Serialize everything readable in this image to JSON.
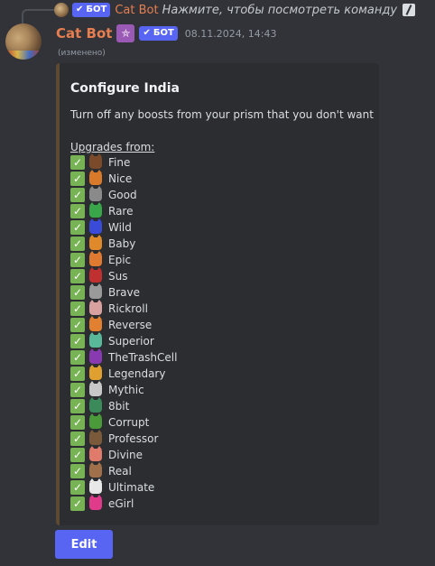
{
  "reply": {
    "author": "Cat Bot",
    "bot_tag": "БОТ",
    "text": "Нажмите, чтобы посмотреть команду"
  },
  "message": {
    "author": "Cat Bot",
    "bot_tag": "БОТ",
    "timestamp": "08.11.2024, 14:43",
    "edited": "(изменено)",
    "author_color": "#e67e50"
  },
  "embed": {
    "title": "Configure India",
    "description": "Turn off any boosts from your prism that you don't want",
    "upgrades_label": "Upgrades from:",
    "accent_color": "#5c4a32",
    "items": [
      {
        "label": "Fine",
        "color": "#7a4a2a"
      },
      {
        "label": "Nice",
        "color": "#d97a2a"
      },
      {
        "label": "Good",
        "color": "#8a8a8a"
      },
      {
        "label": "Rare",
        "color": "#3aa64a"
      },
      {
        "label": "Wild",
        "color": "#3a4ad9"
      },
      {
        "label": "Baby",
        "color": "#e0892a"
      },
      {
        "label": "Epic",
        "color": "#e07a30"
      },
      {
        "label": "Sus",
        "color": "#c03030"
      },
      {
        "label": "Brave",
        "color": "#9a9a9a"
      },
      {
        "label": "Rickroll",
        "color": "#d9a0a0"
      },
      {
        "label": "Reverse",
        "color": "#e08030"
      },
      {
        "label": "Superior",
        "color": "#5ab89a"
      },
      {
        "label": "TheTrashCell",
        "color": "#8a3ab0"
      },
      {
        "label": "Legendary",
        "color": "#e0a030"
      },
      {
        "label": "Mythic",
        "color": "#c8c8c8"
      },
      {
        "label": "8bit",
        "color": "#3a8a5a"
      },
      {
        "label": "Corrupt",
        "color": "#4a9a3a"
      },
      {
        "label": "Professor",
        "color": "#7a5a3a"
      },
      {
        "label": "Divine",
        "color": "#e07a6a"
      },
      {
        "label": "Real",
        "color": "#a0704a"
      },
      {
        "label": "Ultimate",
        "color": "#e8e8e8"
      },
      {
        "label": "eGirl",
        "color": "#e03a8a"
      }
    ]
  },
  "edit_button": {
    "label": "Edit",
    "color": "#5865f2"
  },
  "icons": {
    "check": "white-check-mark-icon",
    "bot_verified": "checkmark-icon",
    "role": "prism-role-icon",
    "slash_command": "slash-command-icon"
  }
}
